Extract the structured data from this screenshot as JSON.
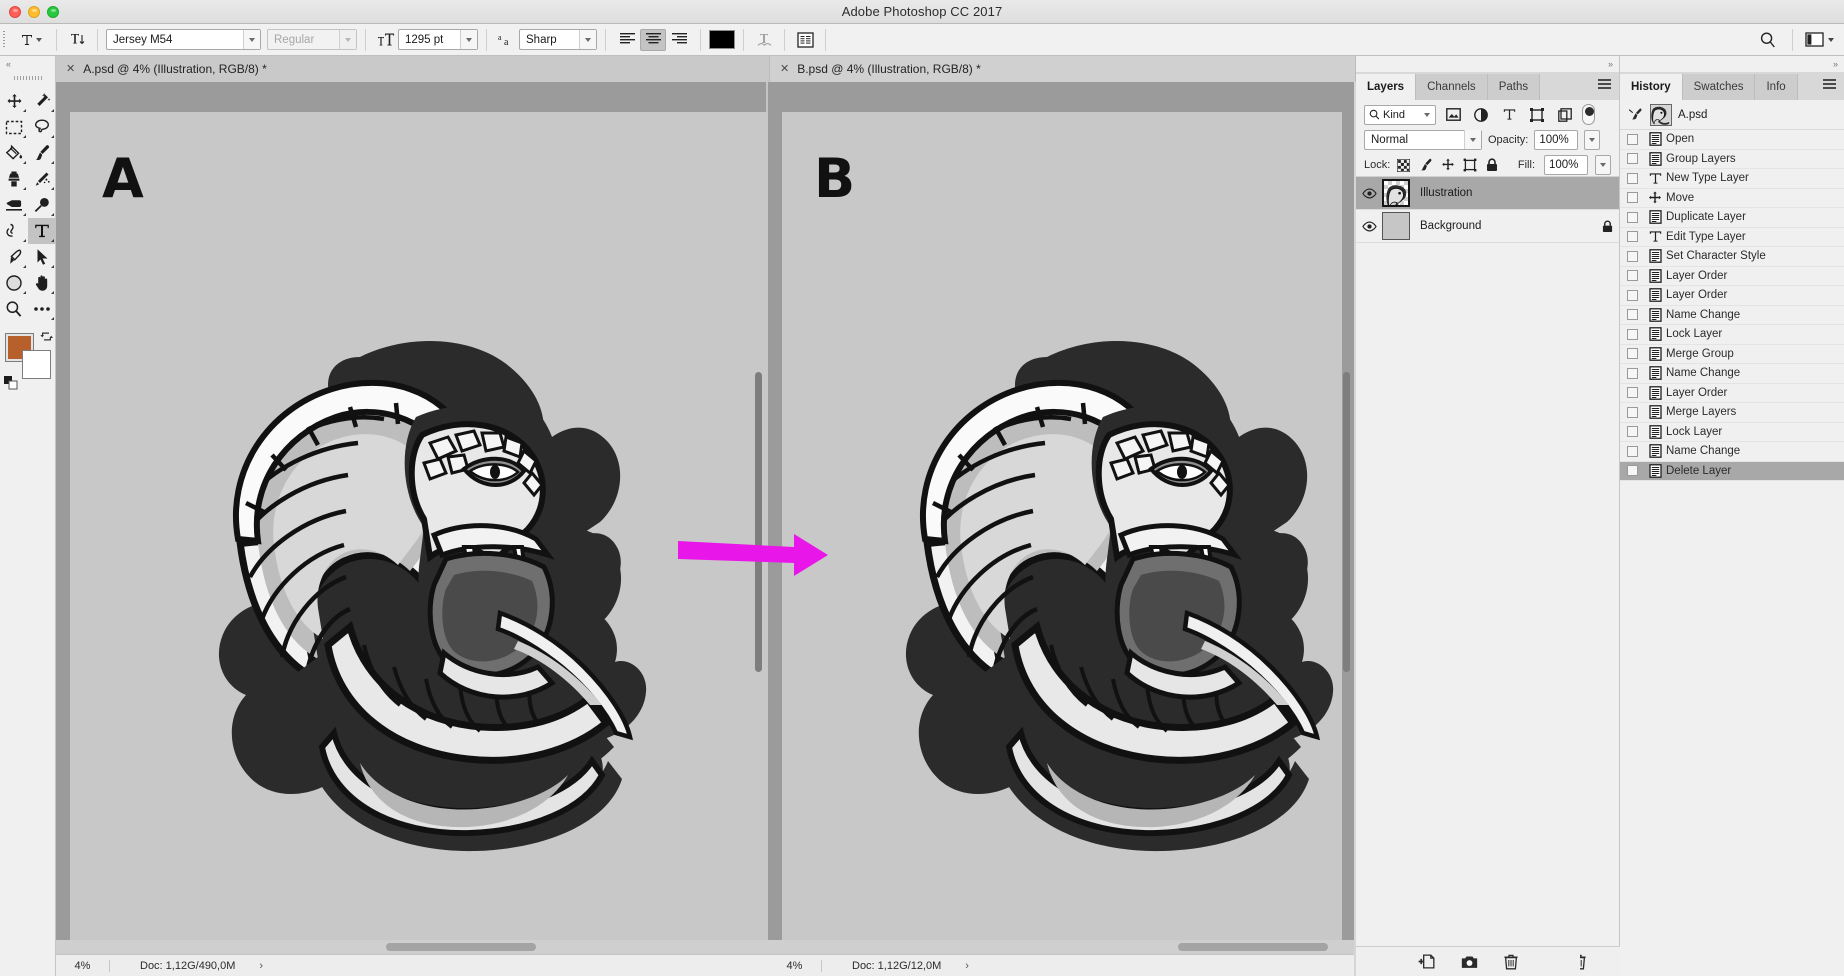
{
  "window": {
    "title": "Adobe Photoshop CC 2017",
    "traffic_lights": [
      "close",
      "minimize",
      "zoom"
    ]
  },
  "options_bar": {
    "tool_icon": "type-tool-icon",
    "orientation_icon": "text-orientation-icon",
    "font_family": "Jersey M54",
    "font_style": "Regular",
    "size_icon": "font-size-icon",
    "font_size": "1295 pt",
    "antialias_icon": "anti-aliasing-icon",
    "antialias": "Sharp",
    "align_left": "align-left-icon",
    "align_center": "align-center-icon",
    "align_right": "align-right-icon",
    "color_swatch": "#000000",
    "warp_icon": "warp-text-icon",
    "panels_icon": "character-paragraph-panels-icon",
    "search_icon": "search-icon",
    "workspace_icon": "workspace-switcher-icon",
    "workspace_caret": "chevron-down-icon"
  },
  "toolbar": {
    "collapse_icon": "collapse-panel-icon",
    "tools": [
      {
        "name": "move-tool",
        "icon": "move-icon",
        "selected": false
      },
      {
        "name": "quick-selection-tool",
        "icon": "magic-wand-icon",
        "selected": false
      },
      {
        "name": "marquee-tool",
        "icon": "rectangular-marquee-icon",
        "selected": false
      },
      {
        "name": "lasso-tool",
        "icon": "lasso-icon",
        "selected": false
      },
      {
        "name": "gradient-tool",
        "icon": "paint-bucket-icon",
        "selected": false
      },
      {
        "name": "brush-tool",
        "icon": "brush-icon",
        "selected": false
      },
      {
        "name": "clone-stamp-tool",
        "icon": "clone-stamp-icon",
        "selected": false
      },
      {
        "name": "healing-brush-tool",
        "icon": "spot-healing-icon",
        "selected": false
      },
      {
        "name": "eraser-tool",
        "icon": "eraser-icon",
        "selected": false
      },
      {
        "name": "dodge-tool",
        "icon": "dodge-icon",
        "selected": false
      },
      {
        "name": "blur-tool",
        "icon": "smudge-icon",
        "selected": false
      },
      {
        "name": "type-tool",
        "icon": "type-icon",
        "selected": true
      },
      {
        "name": "pen-tool",
        "icon": "pen-icon",
        "selected": false
      },
      {
        "name": "path-selection-tool",
        "icon": "path-selection-icon",
        "selected": false
      },
      {
        "name": "shape-tool",
        "icon": "ellipse-shape-icon",
        "selected": false
      },
      {
        "name": "hand-tool",
        "icon": "hand-icon",
        "selected": false
      },
      {
        "name": "zoom-tool",
        "icon": "zoom-icon",
        "selected": false
      },
      {
        "name": "edit-toolbar",
        "icon": "more-tools-icon",
        "selected": false
      }
    ],
    "foreground_color": "#b8602b",
    "background_color": "#ffffff",
    "swap_icon": "swap-colors-icon",
    "default_icon": "default-colors-icon"
  },
  "documents": {
    "tabs": [
      {
        "name": "doc-tab-a",
        "label": "A.psd @ 4% (Illustration, RGB/8) *",
        "active": true,
        "close_icon": "close-icon"
      },
      {
        "name": "doc-tab-b",
        "label": "B.psd @ 4% (Illustration, RGB/8) *",
        "active": false,
        "close_icon": "close-icon"
      }
    ],
    "panes": [
      {
        "id": "pane-a",
        "letter": "A",
        "status": {
          "zoom": "4%",
          "doc": "Doc: 1,12G/490,0M",
          "arrow": "›"
        }
      },
      {
        "id": "pane-b",
        "letter": "B",
        "status": {
          "zoom": "4%",
          "doc": "Doc: 1,12G/12,0M",
          "arrow": "›"
        }
      }
    ],
    "annotation": {
      "name": "magenta-arrow-annotation",
      "color": "#e916e9"
    }
  },
  "layers_panel": {
    "tabs": [
      {
        "label": "Layers",
        "active": true
      },
      {
        "label": "Channels",
        "active": false
      },
      {
        "label": "Paths",
        "active": false
      }
    ],
    "menu_icon": "panel-menu-icon",
    "filter": {
      "search_icon": "search-icon",
      "kind": "Kind",
      "caret": "chevron-down-icon",
      "type_filters": [
        "pixel-layer-filter-icon",
        "adjustment-layer-filter-icon",
        "type-layer-filter-icon",
        "shape-layer-filter-icon",
        "smart-object-filter-icon"
      ],
      "toggle": "filter-toggle-switch"
    },
    "blend_mode": "Normal",
    "opacity_label": "Opacity:",
    "opacity_value": "100%",
    "lock_label": "Lock:",
    "lock_icons": [
      "lock-transparent-pixels-icon",
      "lock-image-pixels-icon",
      "lock-position-icon",
      "lock-artboard-nesting-icon",
      "lock-all-icon"
    ],
    "fill_label": "Fill:",
    "fill_value": "100%",
    "layers": [
      {
        "name": "Illustration",
        "visible": true,
        "selected": true,
        "thumb": "checker",
        "locked": false
      },
      {
        "name": "Background",
        "visible": true,
        "selected": false,
        "thumb": "gray",
        "locked": true
      }
    ],
    "footer_icons": [
      "link-layers-icon",
      "layer-style-fx-icon",
      "layer-mask-icon",
      "adjustment-layer-icon",
      "new-group-icon",
      "new-layer-icon",
      "delete-layer-icon"
    ]
  },
  "history_panel": {
    "tabs": [
      {
        "label": "History",
        "active": true
      },
      {
        "label": "Swatches",
        "active": false
      },
      {
        "label": "Info",
        "active": false
      }
    ],
    "menu_icon": "panel-menu-icon",
    "source": {
      "brush_icon": "history-brush-source-icon",
      "snapshot_label": "A.psd"
    },
    "states": [
      {
        "label": "Open",
        "icon": "document-state-icon",
        "current": false
      },
      {
        "label": "Group Layers",
        "icon": "document-state-icon",
        "current": false
      },
      {
        "label": "New Type Layer",
        "icon": "type-state-icon",
        "current": false
      },
      {
        "label": "Move",
        "icon": "move-state-icon",
        "current": false
      },
      {
        "label": "Duplicate Layer",
        "icon": "document-state-icon",
        "current": false
      },
      {
        "label": "Edit Type Layer",
        "icon": "type-state-icon",
        "current": false
      },
      {
        "label": "Set Character Style",
        "icon": "document-state-icon",
        "current": false
      },
      {
        "label": "Layer Order",
        "icon": "document-state-icon",
        "current": false
      },
      {
        "label": "Layer Order",
        "icon": "document-state-icon",
        "current": false
      },
      {
        "label": "Name Change",
        "icon": "document-state-icon",
        "current": false
      },
      {
        "label": "Lock Layer",
        "icon": "document-state-icon",
        "current": false
      },
      {
        "label": "Merge Group",
        "icon": "document-state-icon",
        "current": false
      },
      {
        "label": "Name Change",
        "icon": "document-state-icon",
        "current": false
      },
      {
        "label": "Layer Order",
        "icon": "document-state-icon",
        "current": false
      },
      {
        "label": "Merge Layers",
        "icon": "document-state-icon",
        "current": false
      },
      {
        "label": "Lock Layer",
        "icon": "document-state-icon",
        "current": false
      },
      {
        "label": "Name Change",
        "icon": "document-state-icon",
        "current": false
      },
      {
        "label": "Delete Layer",
        "icon": "document-state-icon",
        "current": true
      }
    ],
    "footer_icons": [
      "create-document-from-state-icon",
      "create-snapshot-icon",
      "delete-state-icon"
    ]
  }
}
